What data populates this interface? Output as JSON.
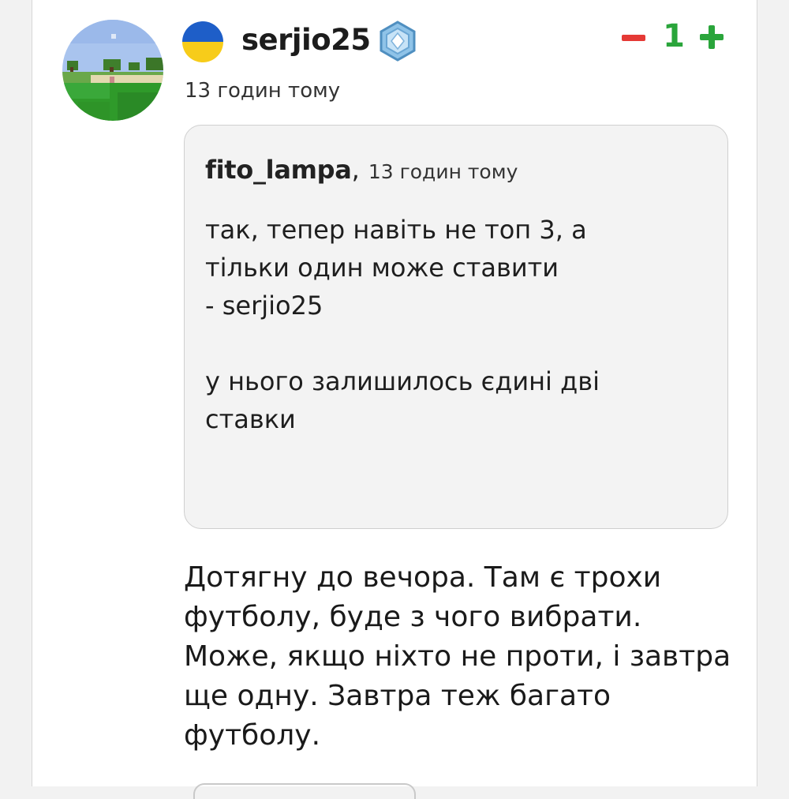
{
  "comment": {
    "author": "serjio25",
    "timestamp": "13 годин тому",
    "avatar_icon": "minecraft-landscape-avatar",
    "flag_icon": "ukraine-flag-icon",
    "badge_icon": "crystal-rank-badge-icon",
    "votes": {
      "minus_icon": "minus-icon",
      "count": "1",
      "plus_icon": "plus-icon",
      "minus_color": "#e53935",
      "plus_color": "#2aa53b"
    },
    "quote": {
      "author": "fito_lampa",
      "separator": ",",
      "timestamp": "13 годин тому",
      "text": "так, тепер навіть не топ 3, а\nтільки один може ставити\n- serjio25\n\nу нього залишилось єдині дві\nставки"
    },
    "text": "Дотягну до вечора. Там є трохи футболу, буде з чого вибрати. Може, якщо ніхто не проти, і завтра ще одну. Завтра теж багато футболу."
  }
}
